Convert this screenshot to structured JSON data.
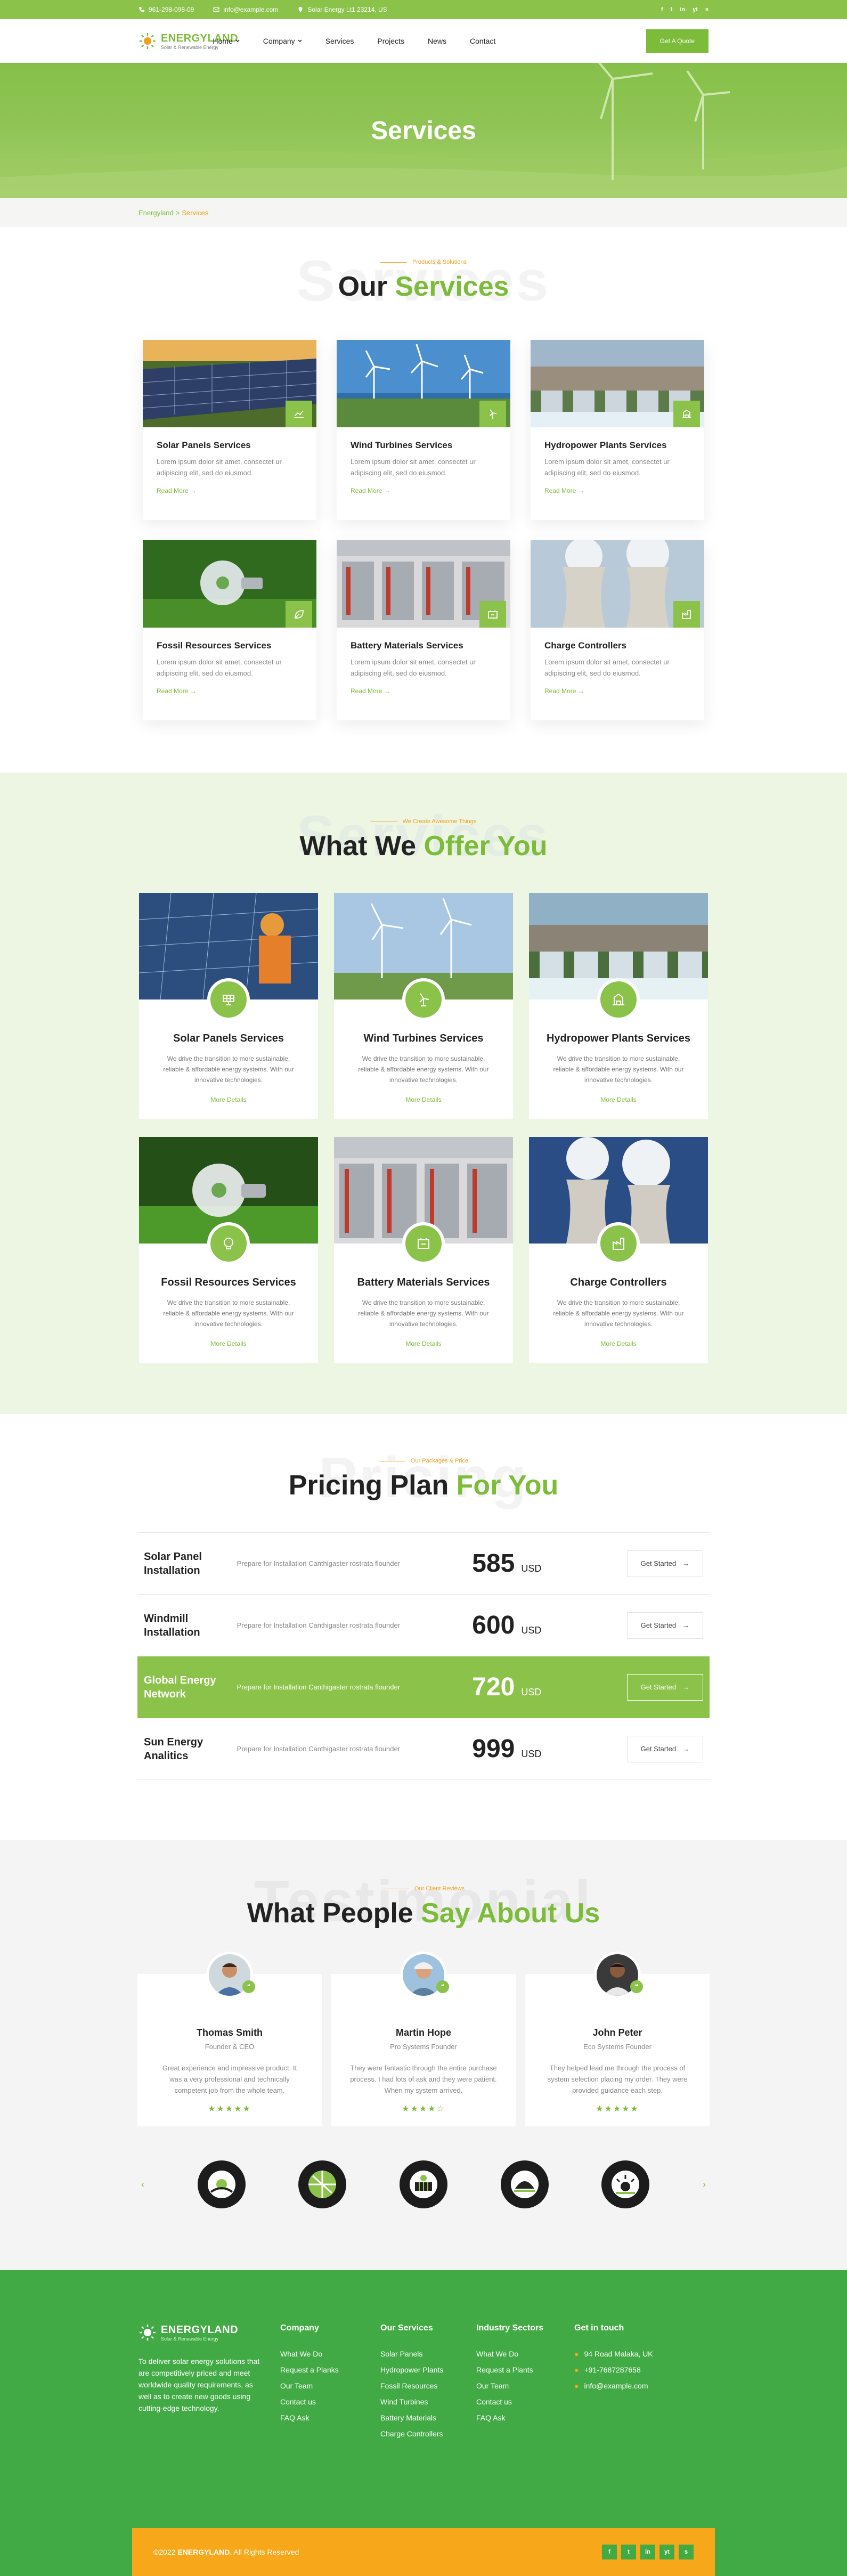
{
  "topbar": {
    "phone": "961-298-098-09",
    "email": "info@example.com",
    "address": "Solar Energy Lt1 23214, US",
    "social": [
      "f",
      "t",
      "in",
      "yt",
      "s"
    ]
  },
  "nav": {
    "logo_name": "ENERGYLAND",
    "logo_tag": "Solar & Renewable Energy",
    "menu": [
      "Home",
      "Company",
      "Services",
      "Projects",
      "News",
      "Contact"
    ],
    "cta": "Get A Quote"
  },
  "hero": {
    "title": "Services"
  },
  "breadcrumb": {
    "home": "Energyland",
    "sep": ">",
    "current": "Services"
  },
  "services_section": {
    "ghost": "Services",
    "kicker": "Products & Solutions",
    "title_a": "Our",
    "title_b": "Services",
    "cards": [
      {
        "title": "Solar Panels Services",
        "text": "Lorem ipsum dolor sit amet, consectet ur adipiscing elit, sed do eiusmod.",
        "more": "Read More →"
      },
      {
        "title": "Wind Turbines Services",
        "text": "Lorem ipsum dolor sit amet, consectet ur adipiscing elit, sed do eiusmod.",
        "more": "Read More →"
      },
      {
        "title": "Hydropower Plants Services",
        "text": "Lorem ipsum dolor sit amet, consectet ur adipiscing elit, sed do eiusmod.",
        "more": "Read More →"
      },
      {
        "title": "Fossil Resources Services",
        "text": "Lorem ipsum dolor sit amet, consectet ur adipiscing elit, sed do eiusmod.",
        "more": "Read More →"
      },
      {
        "title": "Battery Materials Services",
        "text": "Lorem ipsum dolor sit amet, consectet ur adipiscing elit, sed do eiusmod.",
        "more": "Read More →"
      },
      {
        "title": "Charge Controllers",
        "text": "Lorem ipsum dolor sit amet, consectet ur adipiscing elit, sed do eiusmod.",
        "more": "Read More →"
      }
    ]
  },
  "offer_section": {
    "ghost": "Services",
    "kicker": "We Create Awesome Things",
    "title_a": "What We",
    "title_b": "Offer You",
    "cards": [
      {
        "title": "Solar Panels Services",
        "text": "We drive the transition to more sustainable, reliable & affordable energy systems. With our innovative technologies.",
        "more": "More Details"
      },
      {
        "title": "Wind Turbines Services",
        "text": "We drive the transition to more sustainable, reliable & affordable energy systems. With our innovative technologies.",
        "more": "More Details"
      },
      {
        "title": "Hydropower Plants Services",
        "text": "We drive the transition to more sustainable, reliable & affordable energy systems. With our innovative technologies.",
        "more": "More Details"
      },
      {
        "title": "Fossil Resources Services",
        "text": "We drive the transition to more sustainable, reliable & affordable energy systems. With our innovative technologies.",
        "more": "More Details"
      },
      {
        "title": "Battery Materials Services",
        "text": "We drive the transition to more sustainable, reliable & affordable energy systems. With our innovative technologies.",
        "more": "More Details"
      },
      {
        "title": "Charge Controllers",
        "text": "We drive the transition to more sustainable, reliable & affordable energy systems. With our innovative technologies.",
        "more": "More Details"
      }
    ]
  },
  "pricing_section": {
    "ghost": "Pricing",
    "kicker": "Our Packages & Price",
    "title_a": "Pricing Plan",
    "title_b": "For You",
    "rows": [
      {
        "name": "Solar Panel Installation",
        "desc": "Prepare for Installation Canthigaster rostrata flounder",
        "price": "585",
        "unit": "USD",
        "cta": "Get Started",
        "active": false
      },
      {
        "name": "Windmill Installation",
        "desc": "Prepare for Installation Canthigaster rostrata flounder",
        "price": "600",
        "unit": "USD",
        "cta": "Get Started",
        "active": false
      },
      {
        "name": "Global Energy Network",
        "desc": "Prepare for Installation Canthigaster rostrata flounder",
        "price": "720",
        "unit": "USD",
        "cta": "Get Started",
        "active": true
      },
      {
        "name": "Sun Energy Analitics",
        "desc": "Prepare for Installation Canthigaster rostrata flounder",
        "price": "999",
        "unit": "USD",
        "cta": "Get Started",
        "active": false
      }
    ]
  },
  "testimonials_section": {
    "ghost": "Testimonial",
    "kicker": "Our Client Reviews",
    "title_a": "What People",
    "title_b": "Say About Us",
    "items": [
      {
        "name": "Thomas Smith",
        "role": "Founder & CEO",
        "text": "Great experience and impressive product. It was a very professional and technically competent job from the whole team.",
        "stars": "★★★★★"
      },
      {
        "name": "Martin Hope",
        "role": "Pro Systems Founder",
        "text": "They were fantastic through the entire purchase process. I had lots of ask and they were patient. When my system arrived.",
        "stars": "★★★★☆"
      },
      {
        "name": "John Peter",
        "role": "Eco Systems Founder",
        "text": "They helped lead me through the process of system selection placing my order. They were provided guidance each step.",
        "stars": "★★★★★"
      }
    ],
    "prev": "‹",
    "next": "›"
  },
  "footer": {
    "logo_name": "ENERGYLAND",
    "logo_tag": "Solar & Renewable Energy",
    "about": "To deliver solar energy solutions that are competitively priced and meet worldwide quality requirements, as well as to create new goods using cutting-edge technology.",
    "columns": [
      {
        "title": "Company",
        "links": [
          "What We Do",
          "Request a Planks",
          "Our Team",
          "Contact us",
          "FAQ Ask"
        ]
      },
      {
        "title": "Our Services",
        "links": [
          "Solar Panels",
          "Hydropower Plants",
          "Fossil Resources",
          "Wind Turbines",
          "Battery Materials",
          "Charge Controllers"
        ]
      },
      {
        "title": "Industry Sectors",
        "links": [
          "What We Do",
          "Request a Plants",
          "Our Team",
          "Contact us",
          "FAQ Ask"
        ]
      }
    ],
    "contact_title": "Get in touch",
    "contact": [
      "94 Road Malaka, UK",
      "+91-7687287658",
      "info@example.com"
    ],
    "copyright_pre": "©2022",
    "copyright_brand": "ENERGYLAND.",
    "copyright_post": "All Rights Reserved",
    "social": [
      "f",
      "t",
      "in",
      "yt",
      "s"
    ]
  },
  "colors": {
    "brand": "#7cbc3a",
    "accent": "#f0a020",
    "footer": "#42aa45",
    "footer_bar": "#f7a81a"
  }
}
